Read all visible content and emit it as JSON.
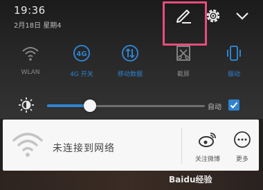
{
  "status": {
    "time": "19:36",
    "date": "2月18日 星期4"
  },
  "header_icons": {
    "edit": "edit-pencil-icon",
    "settings": "gear-icon",
    "collapse": "chevron-down-icon",
    "highlight_color": "#e94d7c"
  },
  "toggles": [
    {
      "label": "WLAN",
      "icon": "wifi-icon",
      "state": "off"
    },
    {
      "label": "4G 开关",
      "icon": "4g-icon",
      "state": "on"
    },
    {
      "label": "移动数据",
      "icon": "mobile-data-icon",
      "state": "on"
    },
    {
      "label": "截屏",
      "icon": "screenshot-icon",
      "state": "off"
    },
    {
      "label": "振动",
      "icon": "vibrate-icon",
      "state": "on"
    }
  ],
  "brightness": {
    "level": 0.27,
    "auto_label": "自动",
    "auto_checked": true
  },
  "network_card": {
    "status_text": "未连接到网络",
    "actions": [
      {
        "label": "关注微博",
        "icon": "weibo-icon"
      },
      {
        "label": "更多",
        "icon": "more-icon"
      }
    ]
  },
  "watermark": "Baidu经验",
  "colors": {
    "accent": "#2f83cf",
    "inactive": "#8a8a8a"
  }
}
